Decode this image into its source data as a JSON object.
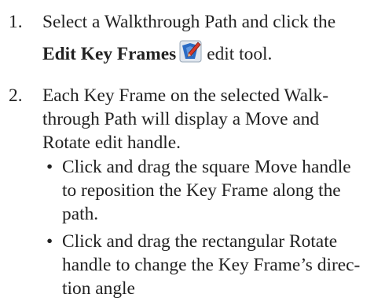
{
  "steps": [
    {
      "number": "1.",
      "line1": "Select a Walkthrough Path and click the",
      "bold_label": "Edit Key Frames",
      "icon": "edit-key-frames-icon",
      "line2_tail": "edit tool."
    },
    {
      "number": "2.",
      "lines": [
        "Each Key Frame on the selected Walk-",
        "through Path will display a Move and",
        "Rotate edit handle."
      ]
    }
  ],
  "bullets": [
    {
      "marker": "•",
      "lines": [
        "Click and drag the square Move handle",
        "to reposition the Key Frame along the",
        "path."
      ]
    },
    {
      "marker": "•",
      "lines": [
        "Click and drag the rectangular Rotate",
        "handle to change the Key Frame’s direc-",
        "tion angle"
      ]
    }
  ],
  "colors": {
    "text": "#222222",
    "icon_blue": "#2b6cc4",
    "icon_bg": "#dfe6ee",
    "icon_red": "#d63a2a"
  }
}
